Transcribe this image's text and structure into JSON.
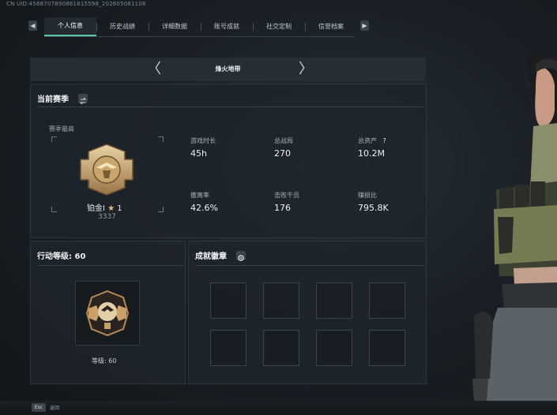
{
  "header": {
    "uid_text": "CN UID:4568707890861815598_202605081108",
    "tab_prev_icon": "chevron-left-icon",
    "tab_next_icon": "chevron-right-icon",
    "tabs": [
      {
        "label": "个人信息",
        "active": true
      },
      {
        "label": "历史战绩",
        "active": false
      },
      {
        "label": "详细数据",
        "active": false
      },
      {
        "label": "账号成就",
        "active": false
      },
      {
        "label": "社交定制",
        "active": false
      },
      {
        "label": "信誉档案",
        "active": false
      }
    ],
    "accent_color": "#5fc9a6"
  },
  "map_selector": {
    "name": "烽火地带",
    "prev_glyph": "〈",
    "next_glyph": "〉"
  },
  "season": {
    "title": "当前赛季",
    "season_best_label": "赛季最高",
    "rank_name": "铂金Ⅰ",
    "rank_star_glyph": "★",
    "rank_stars": "1",
    "rank_points": "3337",
    "stats": [
      {
        "label": "游戏时长",
        "value": "45h"
      },
      {
        "label": "总战局",
        "value": "270"
      },
      {
        "label": "总资产",
        "value": "10.2M",
        "help": "?"
      },
      {
        "label": "撤离率",
        "value": "42.6%"
      },
      {
        "label": "击败干员",
        "value": "176"
      },
      {
        "label": "赚损比",
        "value": "795.8K"
      }
    ]
  },
  "action_level": {
    "title": "行动等级: 60",
    "level_caption": "等级: 60"
  },
  "achievements": {
    "title": "成就徽章",
    "slot_count": 8
  },
  "footer": {
    "key_label": "Esc",
    "action_label": "返回"
  }
}
